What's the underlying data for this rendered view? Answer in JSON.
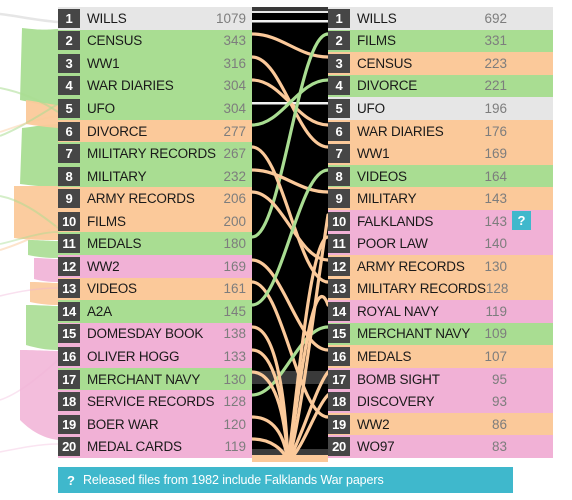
{
  "chart_data": {
    "type": "bar",
    "title": "",
    "subtitle": "",
    "xlabel": "",
    "ylabel": "",
    "grid": false,
    "legend_position": "none",
    "colors": {
      "grey": "#e6e6e6",
      "green": "#a9dd92",
      "orange": "#fbc99a",
      "pink": "#f1b1d6",
      "panel": "#000000",
      "accent_teal": "#3fb8cc",
      "rank_chip": "#464646",
      "value_text": "#7d7d7d",
      "label_text": "#1a1a1a"
    },
    "series": [
      {
        "name": "left_ranking",
        "categories": [
          "WILLS",
          "CENSUS",
          "WW1",
          "WAR DIARIES",
          "UFO",
          "DIVORCE",
          "MILITARY RECORDS",
          "MILITARY",
          "ARMY RECORDS",
          "FILMS",
          "MEDALS",
          "WW2",
          "VIDEOS",
          "A2A",
          "DOMESDAY BOOK",
          "OLIVER HOGG",
          "MERCHANT NAVY",
          "SERVICE RECORDS",
          "BOER WAR",
          "MEDAL CARDS"
        ],
        "values": [
          1079,
          343,
          316,
          304,
          304,
          277,
          267,
          232,
          206,
          200,
          180,
          169,
          161,
          145,
          138,
          133,
          130,
          128,
          120,
          119
        ]
      },
      {
        "name": "right_ranking",
        "categories": [
          "WILLS",
          "FILMS",
          "CENSUS",
          "DIVORCE",
          "UFO",
          "WAR DIARIES",
          "WW1",
          "VIDEOS",
          "MILITARY",
          "FALKLANDS",
          "POOR LAW",
          "ARMY RECORDS",
          "MILITARY RECORDS",
          "ROYAL NAVY",
          "MERCHANT NAVY",
          "MEDALS",
          "BOMB SIGHT",
          "DISCOVERY",
          "WW2",
          "WO97"
        ],
        "values": [
          692,
          331,
          223,
          221,
          196,
          176,
          169,
          164,
          143,
          143,
          140,
          130,
          128,
          119,
          109,
          107,
          95,
          93,
          86,
          83
        ]
      }
    ]
  },
  "left_list": {
    "rows": [
      {
        "rank": "1",
        "label": "WILLS",
        "value": "1079",
        "color": "grey"
      },
      {
        "rank": "2",
        "label": "CENSUS",
        "value": "343",
        "color": "green"
      },
      {
        "rank": "3",
        "label": "WW1",
        "value": "316",
        "color": "green"
      },
      {
        "rank": "4",
        "label": "WAR DIARIES",
        "value": "304",
        "color": "green"
      },
      {
        "rank": "5",
        "label": "UFO",
        "value": "304",
        "color": "green"
      },
      {
        "rank": "6",
        "label": "DIVORCE",
        "value": "277",
        "color": "orange"
      },
      {
        "rank": "7",
        "label": "MILITARY RECORDS",
        "value": "267",
        "color": "green"
      },
      {
        "rank": "8",
        "label": "MILITARY",
        "value": "232",
        "color": "green"
      },
      {
        "rank": "9",
        "label": "ARMY RECORDS",
        "value": "206",
        "color": "orange"
      },
      {
        "rank": "10",
        "label": "FILMS",
        "value": "200",
        "color": "orange"
      },
      {
        "rank": "11",
        "label": "MEDALS",
        "value": "180",
        "color": "green"
      },
      {
        "rank": "12",
        "label": "WW2",
        "value": "169",
        "color": "pink"
      },
      {
        "rank": "13",
        "label": "VIDEOS",
        "value": "161",
        "color": "orange"
      },
      {
        "rank": "14",
        "label": "A2A",
        "value": "145",
        "color": "green"
      },
      {
        "rank": "15",
        "label": "DOMESDAY BOOK",
        "value": "138",
        "color": "pink"
      },
      {
        "rank": "16",
        "label": "OLIVER HOGG",
        "value": "133",
        "color": "pink"
      },
      {
        "rank": "17",
        "label": "MERCHANT NAVY",
        "value": "130",
        "color": "green"
      },
      {
        "rank": "18",
        "label": "SERVICE RECORDS",
        "value": "128",
        "color": "pink"
      },
      {
        "rank": "19",
        "label": "BOER WAR",
        "value": "120",
        "color": "pink"
      },
      {
        "rank": "20",
        "label": "MEDAL CARDS",
        "value": "119",
        "color": "pink"
      }
    ]
  },
  "right_list": {
    "rows": [
      {
        "rank": "1",
        "label": "WILLS",
        "value": "692",
        "color": "grey"
      },
      {
        "rank": "2",
        "label": "FILMS",
        "value": "331",
        "color": "green"
      },
      {
        "rank": "3",
        "label": "CENSUS",
        "value": "223",
        "color": "orange"
      },
      {
        "rank": "4",
        "label": "DIVORCE",
        "value": "221",
        "color": "green"
      },
      {
        "rank": "5",
        "label": "UFO",
        "value": "196",
        "color": "grey"
      },
      {
        "rank": "6",
        "label": "WAR DIARIES",
        "value": "176",
        "color": "orange"
      },
      {
        "rank": "7",
        "label": "WW1",
        "value": "169",
        "color": "orange"
      },
      {
        "rank": "8",
        "label": "VIDEOS",
        "value": "164",
        "color": "green"
      },
      {
        "rank": "9",
        "label": "MILITARY",
        "value": "143",
        "color": "orange"
      },
      {
        "rank": "10",
        "label": "FALKLANDS",
        "value": "143",
        "color": "pink"
      },
      {
        "rank": "11",
        "label": "POOR LAW",
        "value": "140",
        "color": "pink"
      },
      {
        "rank": "12",
        "label": "ARMY RECORDS",
        "value": "130",
        "color": "orange"
      },
      {
        "rank": "13",
        "label": "MILITARY RECORDS",
        "value": "128",
        "color": "orange"
      },
      {
        "rank": "14",
        "label": "ROYAL NAVY",
        "value": "119",
        "color": "pink"
      },
      {
        "rank": "15",
        "label": "MERCHANT NAVY",
        "value": "109",
        "color": "green"
      },
      {
        "rank": "16",
        "label": "MEDALS",
        "value": "107",
        "color": "orange"
      },
      {
        "rank": "17",
        "label": "BOMB SIGHT",
        "value": "95",
        "color": "pink"
      },
      {
        "rank": "18",
        "label": "DISCOVERY",
        "value": "93",
        "color": "pink"
      },
      {
        "rank": "19",
        "label": "WW2",
        "value": "86",
        "color": "orange"
      },
      {
        "rank": "20",
        "label": "WO97",
        "value": "83",
        "color": "pink"
      }
    ]
  },
  "annotation": {
    "badge_symbol": "?",
    "badge_attached_to": "FALKLANDS"
  },
  "footer": {
    "symbol": "?",
    "text": "Released files from 1982 include Falklands War papers"
  }
}
